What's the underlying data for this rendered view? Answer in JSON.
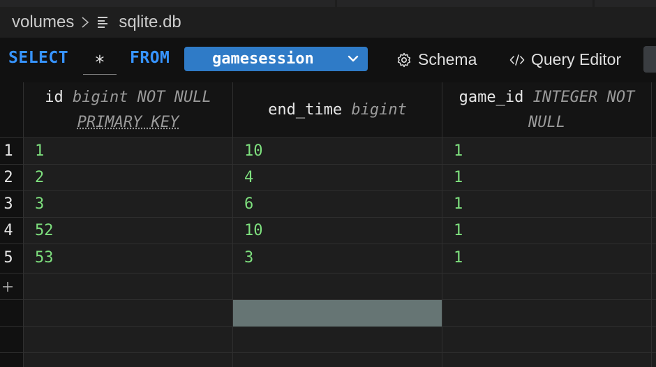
{
  "breadcrumb": {
    "folder": "volumes",
    "separator_icon": "chevron-right-icon",
    "file_icon": "file-lines-icon",
    "file": "sqlite.db"
  },
  "query": {
    "select_kw": "SELECT",
    "columns": "*",
    "from_kw": "FROM",
    "table": "gamesession",
    "table_dropdown_icon": "chevron-down-icon"
  },
  "toolbar": {
    "schema_label": "Schema",
    "schema_icon": "gear-icon",
    "query_editor_label": "Query Editor",
    "query_editor_icon": "code-icon"
  },
  "grid": {
    "columns": [
      {
        "name": "id",
        "type_line1": "bigint NOT NULL",
        "type_line2": "PRIMARY KEY"
      },
      {
        "name": "end_time",
        "type": "bigint"
      },
      {
        "name": "game_id",
        "type_line1": "INTEGER NOT",
        "type_line2": "NULL"
      }
    ],
    "rows": [
      {
        "num": "1",
        "cells": [
          "1",
          "10",
          "1"
        ]
      },
      {
        "num": "2",
        "cells": [
          "2",
          "4",
          "1"
        ]
      },
      {
        "num": "3",
        "cells": [
          "3",
          "6",
          "1"
        ]
      },
      {
        "num": "4",
        "cells": [
          "52",
          "10",
          "1"
        ]
      },
      {
        "num": "5",
        "cells": [
          "53",
          "3",
          "1"
        ]
      }
    ],
    "add_row_icon": "plus-icon"
  },
  "colors": {
    "keyword": "#3794ff",
    "table_select_bg": "#2f7bc7",
    "value": "#7ee07e",
    "selected_cell": "#667574"
  }
}
